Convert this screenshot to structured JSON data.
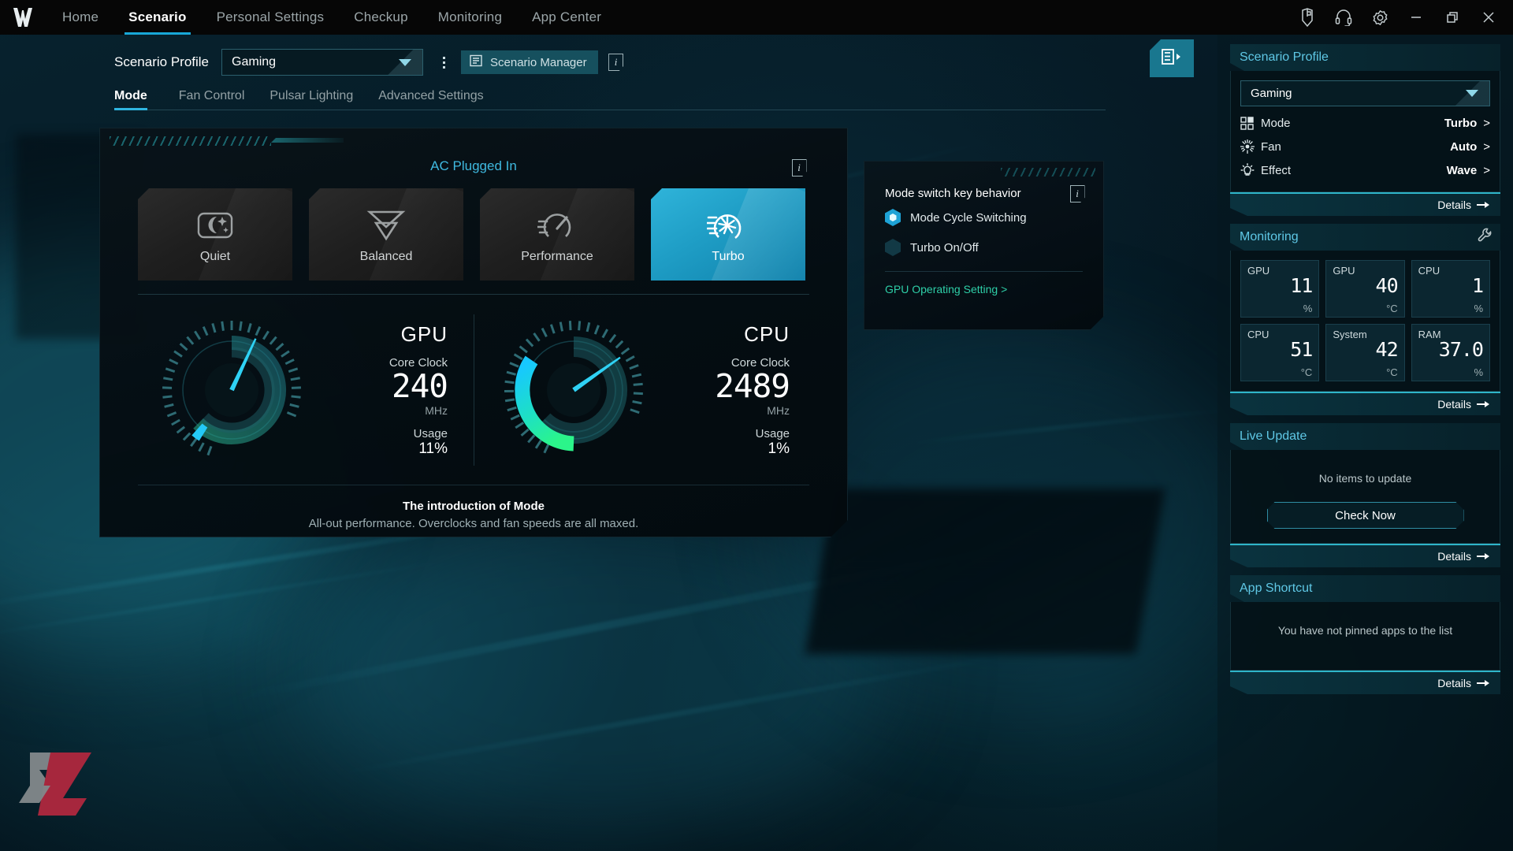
{
  "titlebar": {
    "logo_icon": "predator-logo-icon",
    "nav": [
      {
        "label": "Home",
        "active": false
      },
      {
        "label": "Scenario",
        "active": true
      },
      {
        "label": "Personal Settings",
        "active": false
      },
      {
        "label": "Checkup",
        "active": false
      },
      {
        "label": "Monitoring",
        "active": false
      },
      {
        "label": "App Center",
        "active": false
      }
    ],
    "window_icons": [
      "mouse-icon",
      "headset-icon",
      "gear-icon",
      "minimize-icon",
      "restore-icon",
      "close-icon"
    ]
  },
  "toolbar": {
    "profile_label": "Scenario Profile",
    "profile_value": "Gaming",
    "scenario_manager_label": "Scenario Manager",
    "info_glyph": "i"
  },
  "subtabs": [
    {
      "label": "Mode",
      "active": true
    },
    {
      "label": "Fan Control",
      "active": false
    },
    {
      "label": "Pulsar Lighting",
      "active": false
    },
    {
      "label": "Advanced Settings",
      "active": false
    }
  ],
  "mode_panel": {
    "ac_status": "AC Plugged In",
    "modes": [
      {
        "label": "Quiet",
        "icon": "moon-stars-icon",
        "selected": false
      },
      {
        "label": "Balanced",
        "icon": "double-chevron-down-icon",
        "selected": false
      },
      {
        "label": "Performance",
        "icon": "speedometer-icon",
        "selected": false
      },
      {
        "label": "Turbo",
        "icon": "turbine-fan-icon",
        "selected": true
      }
    ],
    "gauges": [
      {
        "title": "GPU",
        "core_clock_label": "Core Clock",
        "core_clock_value": "240",
        "unit": "MHz",
        "usage_label": "Usage",
        "usage_value": "11%"
      },
      {
        "title": "CPU",
        "core_clock_label": "Core Clock",
        "core_clock_value": "2489",
        "unit": "MHz",
        "usage_label": "Usage",
        "usage_value": "1%"
      }
    ],
    "intro_title": "The introduction of Mode",
    "intro_desc": "All-out performance. Overclocks and fan speeds are all maxed."
  },
  "switch_panel": {
    "title": "Mode switch key behavior",
    "options": [
      {
        "label": "Mode Cycle Switching",
        "selected": true
      },
      {
        "label": "Turbo On/Off",
        "selected": false
      }
    ],
    "link": "GPU Operating Setting >"
  },
  "sidebar": {
    "toggle_icon": "panel-collapse-icon",
    "widgets": {
      "scenario_profile": {
        "title": "Scenario Profile",
        "profile_value": "Gaming",
        "rows": [
          {
            "icon": "grid-squares-icon",
            "label": "Mode",
            "value": "Turbo",
            "chevron": ">"
          },
          {
            "icon": "fan-burst-icon",
            "label": "Fan",
            "value": "Auto",
            "chevron": ">"
          },
          {
            "icon": "lightbulb-icon",
            "label": "Effect",
            "value": "Wave",
            "chevron": ">"
          }
        ],
        "details_label": "Details"
      },
      "monitoring": {
        "title": "Monitoring",
        "tool_icon": "wrench-icon",
        "cells": [
          {
            "label": "GPU",
            "value": "11",
            "unit": "%"
          },
          {
            "label": "GPU",
            "value": "40",
            "unit": "°C"
          },
          {
            "label": "CPU",
            "value": "1",
            "unit": "%"
          },
          {
            "label": "CPU",
            "value": "51",
            "unit": "°C"
          },
          {
            "label": "System",
            "value": "42",
            "unit": "°C"
          },
          {
            "label": "RAM",
            "value": "37.0",
            "unit": "%"
          }
        ],
        "details_label": "Details"
      },
      "live_update": {
        "title": "Live Update",
        "empty_text": "No items to update",
        "button_label": "Check Now",
        "details_label": "Details"
      },
      "app_shortcut": {
        "title": "App Shortcut",
        "empty_text": "You have not pinned apps to the list",
        "details_label": "Details"
      }
    }
  },
  "colors": {
    "accent": "#2fb5e0",
    "accent_dark": "#19778f",
    "link_green": "#2ecfa8",
    "header_text": "#5fc8e6",
    "selected_card": "#1f9ec6"
  },
  "chart_data": [
    {
      "type": "gauge",
      "title": "GPU",
      "value": 11,
      "unit": "%",
      "secondary_label": "Core Clock",
      "secondary_value": 240,
      "secondary_unit": "MHz",
      "range": [
        0,
        100
      ]
    },
    {
      "type": "gauge",
      "title": "CPU",
      "value": 1,
      "unit": "%",
      "secondary_label": "Core Clock",
      "secondary_value": 2489,
      "secondary_unit": "MHz",
      "range": [
        0,
        100
      ]
    }
  ]
}
